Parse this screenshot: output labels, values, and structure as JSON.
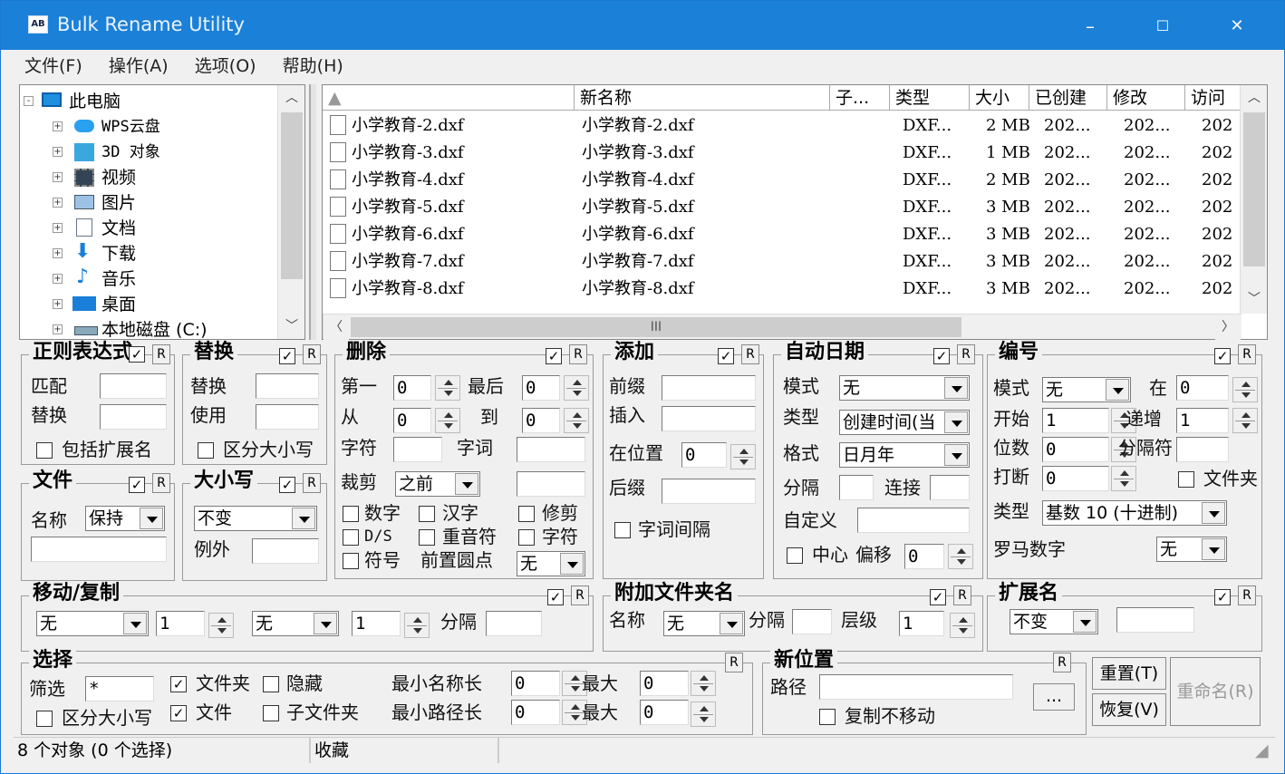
{
  "window": {
    "title": "Bulk Rename Utility",
    "app_icon": "AB",
    "min": "–",
    "max": "☐",
    "close": "✕"
  },
  "menu": [
    "文件(F)",
    "操作(A)",
    "选项(O)",
    "帮助(H)"
  ],
  "tree": {
    "root": "此电脑",
    "items": [
      "WPS云盘",
      "3D 对象",
      "视频",
      "图片",
      "文档",
      "下载",
      "音乐",
      "桌面",
      "本地磁盘 (C:)"
    ]
  },
  "list": {
    "headers": [
      "",
      "新名称",
      "子...",
      "类型",
      "大小",
      "已创建",
      "修改",
      "访问"
    ],
    "rows": [
      [
        "小学教育-2.dxf",
        "小学教育-2.dxf",
        "",
        "DXF...",
        "2 MB",
        "202...",
        "202...",
        "202"
      ],
      [
        "小学教育-3.dxf",
        "小学教育-3.dxf",
        "",
        "DXF...",
        "1 MB",
        "202...",
        "202...",
        "202"
      ],
      [
        "小学教育-4.dxf",
        "小学教育-4.dxf",
        "",
        "DXF...",
        "2 MB",
        "202...",
        "202...",
        "202"
      ],
      [
        "小学教育-5.dxf",
        "小学教育-5.dxf",
        "",
        "DXF...",
        "3 MB",
        "202...",
        "202...",
        "202"
      ],
      [
        "小学教育-6.dxf",
        "小学教育-6.dxf",
        "",
        "DXF...",
        "3 MB",
        "202...",
        "202...",
        "202"
      ],
      [
        "小学教育-7.dxf",
        "小学教育-7.dxf",
        "",
        "DXF...",
        "3 MB",
        "202...",
        "202...",
        "202"
      ],
      [
        "小学教育-8.dxf",
        "小学教育-8.dxf",
        "",
        "DXF...",
        "3 MB",
        "202...",
        "202...",
        "202"
      ]
    ],
    "hscroll_label": "III"
  },
  "regex": {
    "title": "正则表达式",
    "match": "匹配",
    "replace": "替换",
    "include_ext": "包括扩展名"
  },
  "replace": {
    "title": "替换",
    "replace": "替换",
    "with": "使用",
    "case": "区分大小写"
  },
  "remove": {
    "title": "删除",
    "first": "第一",
    "first_val": "0",
    "last": "最后",
    "last_val": "0",
    "from": "从",
    "from_val": "0",
    "to": "到",
    "to_val": "0",
    "chars": "字符",
    "words": "字词",
    "crop": "裁剪",
    "crop_val": "之前",
    "digits": "数字",
    "chinese": "汉字",
    "trim": "修剪",
    "ds": "D/S",
    "accented": "重音符",
    "chars2": "字符",
    "symbols": "符号",
    "leading_dots": "前置圆点",
    "lead_val": "无"
  },
  "add": {
    "title": "添加",
    "prefix": "前缀",
    "insert": "插入",
    "at_pos": "在位置",
    "at_pos_val": "0",
    "suffix": "后缀",
    "word_space": "字词间隔"
  },
  "autodate": {
    "title": "自动日期",
    "mode": "模式",
    "mode_val": "无",
    "type": "类型",
    "type_val": "创建时间(当",
    "format": "格式",
    "format_val": "日月年",
    "sep": "分隔",
    "connect": "连接",
    "custom": "自定义",
    "center": "中心",
    "offset": "偏移",
    "offset_val": "0"
  },
  "numbering": {
    "title": "编号",
    "mode": "模式",
    "mode_val": "无",
    "at": "在",
    "at_val": "0",
    "start": "开始",
    "start_val": "1",
    "incr": "递增",
    "incr_val": "1",
    "pad": "位数",
    "pad_val": "0",
    "sep": "分隔符",
    "break": "打断",
    "break_val": "0",
    "folder": "文件夹",
    "type": "类型",
    "type_val": "基数 10 (十进制)",
    "roman": "罗马数字",
    "roman_val": "无"
  },
  "file": {
    "title": "文件",
    "name": "名称",
    "name_val": "保持"
  },
  "case": {
    "title": "大小写",
    "case_val": "不变",
    "except": "例外"
  },
  "movecopy": {
    "title": "移动/复制",
    "sel1": "无",
    "n1": "1",
    "sel2": "无",
    "n2": "1",
    "sep": "分隔"
  },
  "appendfolder": {
    "title": "附加文件夹名",
    "name": "名称",
    "name_val": "无",
    "sep": "分隔",
    "levels": "层级",
    "levels_val": "1"
  },
  "extension": {
    "title": "扩展名",
    "val": "不变"
  },
  "selection": {
    "title": "选择",
    "filter": "筛选",
    "filter_val": "*",
    "folders": "文件夹",
    "hidden": "隐藏",
    "files": "文件",
    "subfolders": "子文件夹",
    "case": "区分大小写",
    "min_name": "最小名称长",
    "min_name_val": "0",
    "max1": "最大",
    "max1_val": "0",
    "min_path": "最小路径长",
    "min_path_val": "0",
    "max2": "最大",
    "max2_val": "0"
  },
  "newloc": {
    "title": "新位置",
    "path": "路径",
    "browse": "...",
    "copy_not_move": "复制不移动"
  },
  "buttons": {
    "reset": "重置(T)",
    "revert": "恢复(V)",
    "rename": "重命名(R)"
  },
  "status": {
    "objects": "8 个对象 (0 个选择)",
    "favorites": "收藏"
  },
  "misc": {
    "r": "R",
    "check": "✓"
  }
}
